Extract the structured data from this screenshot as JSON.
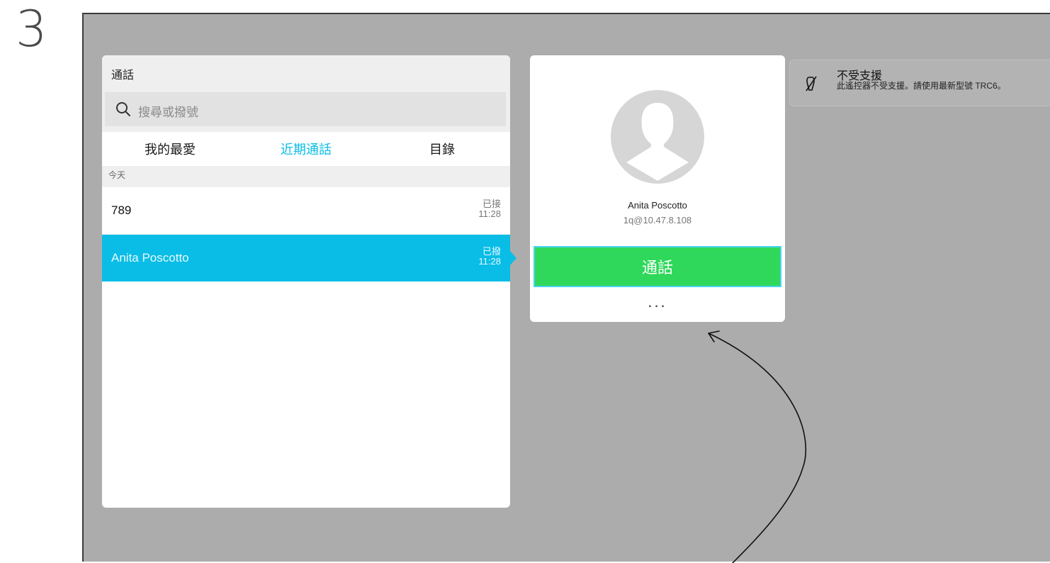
{
  "step_number": "3",
  "calls_panel": {
    "title": "通話",
    "search_placeholder": "搜尋或撥號",
    "tabs": [
      {
        "label": "我的最愛"
      },
      {
        "label": "近期通話"
      },
      {
        "label": "目錄"
      }
    ],
    "active_tab": "近期通話",
    "section_header": "今天",
    "rows": [
      {
        "name": "789",
        "status": "已接",
        "time": "11:28"
      },
      {
        "name": "Anita Poscotto",
        "status": "已撥",
        "time": "11:28"
      }
    ]
  },
  "contact_card": {
    "name": "Anita Poscotto",
    "address": "1q@10.47.8.108",
    "call_label": "通話",
    "more_label": "..."
  },
  "notice": {
    "icon": "unsupported-remote-icon",
    "title": "不受支援",
    "text": "此遙控器不受支援。請使用最新型號 TRC6。"
  },
  "colors": {
    "accent": "#09bde6",
    "call_green": "#2fd85a",
    "screen_gray": "#acacac"
  }
}
